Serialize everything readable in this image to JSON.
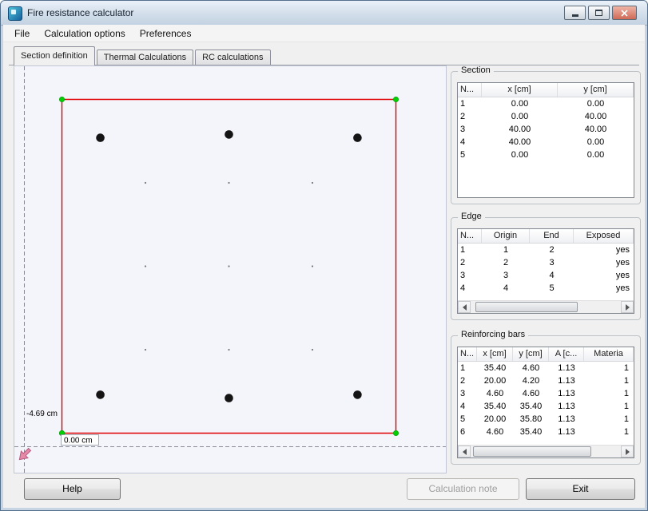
{
  "window": {
    "title": "Fire resistance calculator"
  },
  "menu": {
    "items": [
      "File",
      "Calculation options",
      "Preferences"
    ]
  },
  "tabs": {
    "items": [
      "Section definition",
      "Thermal Calculations",
      "RC calculations"
    ],
    "selected_index": 0
  },
  "canvas": {
    "cursor_y_label": "-4.69 cm",
    "cursor_x_label": "0.00 cm",
    "colors": {
      "outline": "#e00000",
      "vertex": "#00d000",
      "bar": "#141414",
      "arrow": "#e589a6"
    }
  },
  "section_panel": {
    "title": "Section",
    "headers": [
      "N...",
      "x [cm]",
      "y [cm]"
    ],
    "rows": [
      [
        "1",
        "0.00",
        "0.00"
      ],
      [
        "2",
        "0.00",
        "40.00"
      ],
      [
        "3",
        "40.00",
        "40.00"
      ],
      [
        "4",
        "40.00",
        "0.00"
      ],
      [
        "5",
        "0.00",
        "0.00"
      ]
    ]
  },
  "edge_panel": {
    "title": "Edge",
    "headers": [
      "N...",
      "Origin",
      "End",
      "Exposed"
    ],
    "rows": [
      [
        "1",
        "1",
        "2",
        "yes"
      ],
      [
        "2",
        "2",
        "3",
        "yes"
      ],
      [
        "3",
        "3",
        "4",
        "yes"
      ],
      [
        "4",
        "4",
        "5",
        "yes"
      ]
    ]
  },
  "bars_panel": {
    "title": "Reinforcing bars",
    "headers": [
      "N...",
      "x [cm]",
      "y [cm]",
      "A [c...",
      "Materia"
    ],
    "rows": [
      [
        "1",
        "35.40",
        "4.60",
        "1.13",
        "1"
      ],
      [
        "2",
        "20.00",
        "4.20",
        "1.13",
        "1"
      ],
      [
        "3",
        "4.60",
        "4.60",
        "1.13",
        "1"
      ],
      [
        "4",
        "35.40",
        "35.40",
        "1.13",
        "1"
      ],
      [
        "5",
        "20.00",
        "35.80",
        "1.13",
        "1"
      ],
      [
        "6",
        "4.60",
        "35.40",
        "1.13",
        "1"
      ]
    ]
  },
  "buttons": {
    "help": "Help",
    "calculation_note": "Calculation note",
    "exit": "Exit"
  }
}
